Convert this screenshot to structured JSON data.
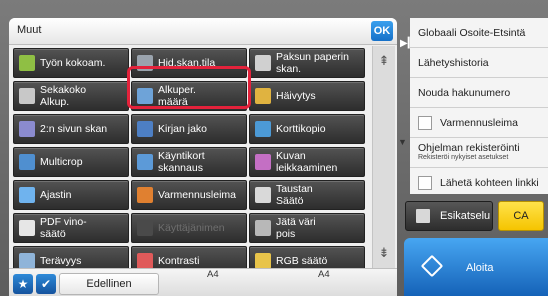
{
  "left_panel": {
    "title": "Muut",
    "ok_label": "OK",
    "buttons": [
      {
        "label": "Työn kokoam.",
        "icon": "job-build-icon",
        "icon_color": "#8fbf44",
        "disabled": false
      },
      {
        "label": "Hid.skan.tila",
        "icon": "slow-scan-icon",
        "icon_color": "#9aa3ad",
        "disabled": false
      },
      {
        "label": "Paksun paperin\nskan.",
        "icon": "thick-paper-icon",
        "icon_color": "#d0d0d0",
        "disabled": false
      },
      {
        "label": "Sekakoko\nAlkup.",
        "icon": "mixed-size-icon",
        "icon_color": "#c8c8c8",
        "disabled": false
      },
      {
        "label": "Alkuper.\nmäärä",
        "icon": "original-count-icon",
        "icon_color": "#6ea3d8",
        "disabled": false
      },
      {
        "label": "Häivytys",
        "icon": "fade-icon",
        "icon_color": "#e0b340",
        "disabled": false
      },
      {
        "label": "2:n sivun skan",
        "icon": "two-page-icon",
        "icon_color": "#8b8bcf",
        "disabled": false
      },
      {
        "label": "Kirjan jako",
        "icon": "book-split-icon",
        "icon_color": "#4d7fc4",
        "disabled": false
      },
      {
        "label": "Korttikopio",
        "icon": "card-copy-icon",
        "icon_color": "#4c9ad6",
        "disabled": false
      },
      {
        "label": "Multicrop",
        "icon": "multicrop-icon",
        "icon_color": "#4f8fd0",
        "disabled": false
      },
      {
        "label": "Käyntikort\nskannaus",
        "icon": "business-card-icon",
        "icon_color": "#5c9ad8",
        "disabled": false
      },
      {
        "label": "Kuvan\nleikkaaminen",
        "icon": "image-crop-icon",
        "icon_color": "#c46fc4",
        "disabled": false
      },
      {
        "label": "Ajastin",
        "icon": "timer-icon",
        "icon_color": "#6fb3ee",
        "disabled": false
      },
      {
        "label": "Varmennusleima",
        "icon": "verify-stamp-icon",
        "icon_color": "#e08030",
        "disabled": false
      },
      {
        "label": "Taustan\nSäätö",
        "icon": "background-adjust-icon",
        "icon_color": "#d9d9d9",
        "disabled": false
      },
      {
        "label": "PDF vino-\nsäätö",
        "icon": "pdf-skew-icon",
        "icon_color": "#e6e6e6",
        "disabled": false
      },
      {
        "label": "Käyttäjänimen",
        "icon": "username-icon",
        "icon_color": "#4a4a4a",
        "disabled": true
      },
      {
        "label": "Jätä väri\npois",
        "icon": "color-omit-icon",
        "icon_color": "#b8b8b8",
        "disabled": false
      },
      {
        "label": "Terävyys",
        "icon": "sharpness-icon",
        "icon_color": "#8fb4d9",
        "disabled": false
      },
      {
        "label": "Kontrasti",
        "icon": "contrast-icon",
        "icon_color": "#e05a5a",
        "disabled": false
      },
      {
        "label": "RGB säätö",
        "icon": "rgb-adjust-icon",
        "icon_color": "#e8c44a",
        "disabled": false
      }
    ],
    "bottom": {
      "star_icon": "star-icon",
      "check_icon": "check-icon",
      "previous_label": "Edellinen",
      "paper_a": "A4",
      "paper_b": "A4"
    }
  },
  "right_panel": {
    "items": [
      {
        "label": "Globaali Osoite-Etsintä"
      },
      {
        "label": "Lähetyshistoria"
      },
      {
        "label": "Nouda hakunumero"
      },
      {
        "label": "Varmennusleima",
        "checkbox": true
      },
      {
        "label": "Ohjelman rekisteröinti",
        "sub": "Rekisteröi nykyiset asetukset"
      },
      {
        "label": "Lähetä kohteen linkki",
        "checkbox": true
      }
    ],
    "preview_label": "Esikatselu",
    "ca_label": "CA",
    "start_label": "Aloita"
  },
  "colors": {
    "accent_blue": "#2b86dc",
    "highlight_red": "#e3223b",
    "ca_yellow": "#f5c400"
  }
}
